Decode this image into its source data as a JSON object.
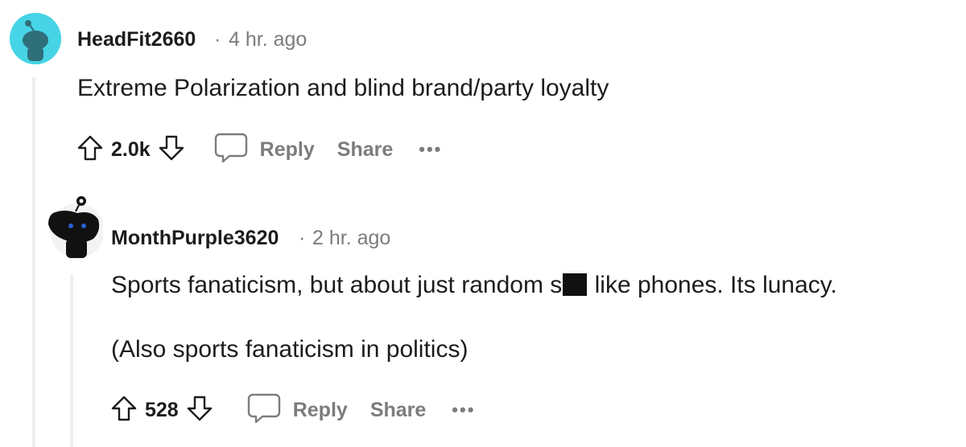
{
  "comments": [
    {
      "username": "HeadFit2660",
      "separator": "·",
      "time": "4 hr. ago",
      "body": [
        "Extreme Polarization and blind brand/party loyalty"
      ],
      "votes": "2.0k",
      "reply_label": "Reply",
      "share_label": "Share",
      "more_label": "•••",
      "avatar_color": "#46d4e6"
    },
    {
      "username": "MonthPurple3620",
      "separator": "·",
      "time": "2 hr. ago",
      "body_before_censor": "Sports fanaticism, but about just random s",
      "body_after_censor": " like phones. Its lunacy.",
      "body_second": "(Also sports fanaticism in politics)",
      "votes": "528",
      "reply_label": "Reply",
      "share_label": "Share",
      "more_label": "•••",
      "avatar_color": "#111111"
    }
  ]
}
